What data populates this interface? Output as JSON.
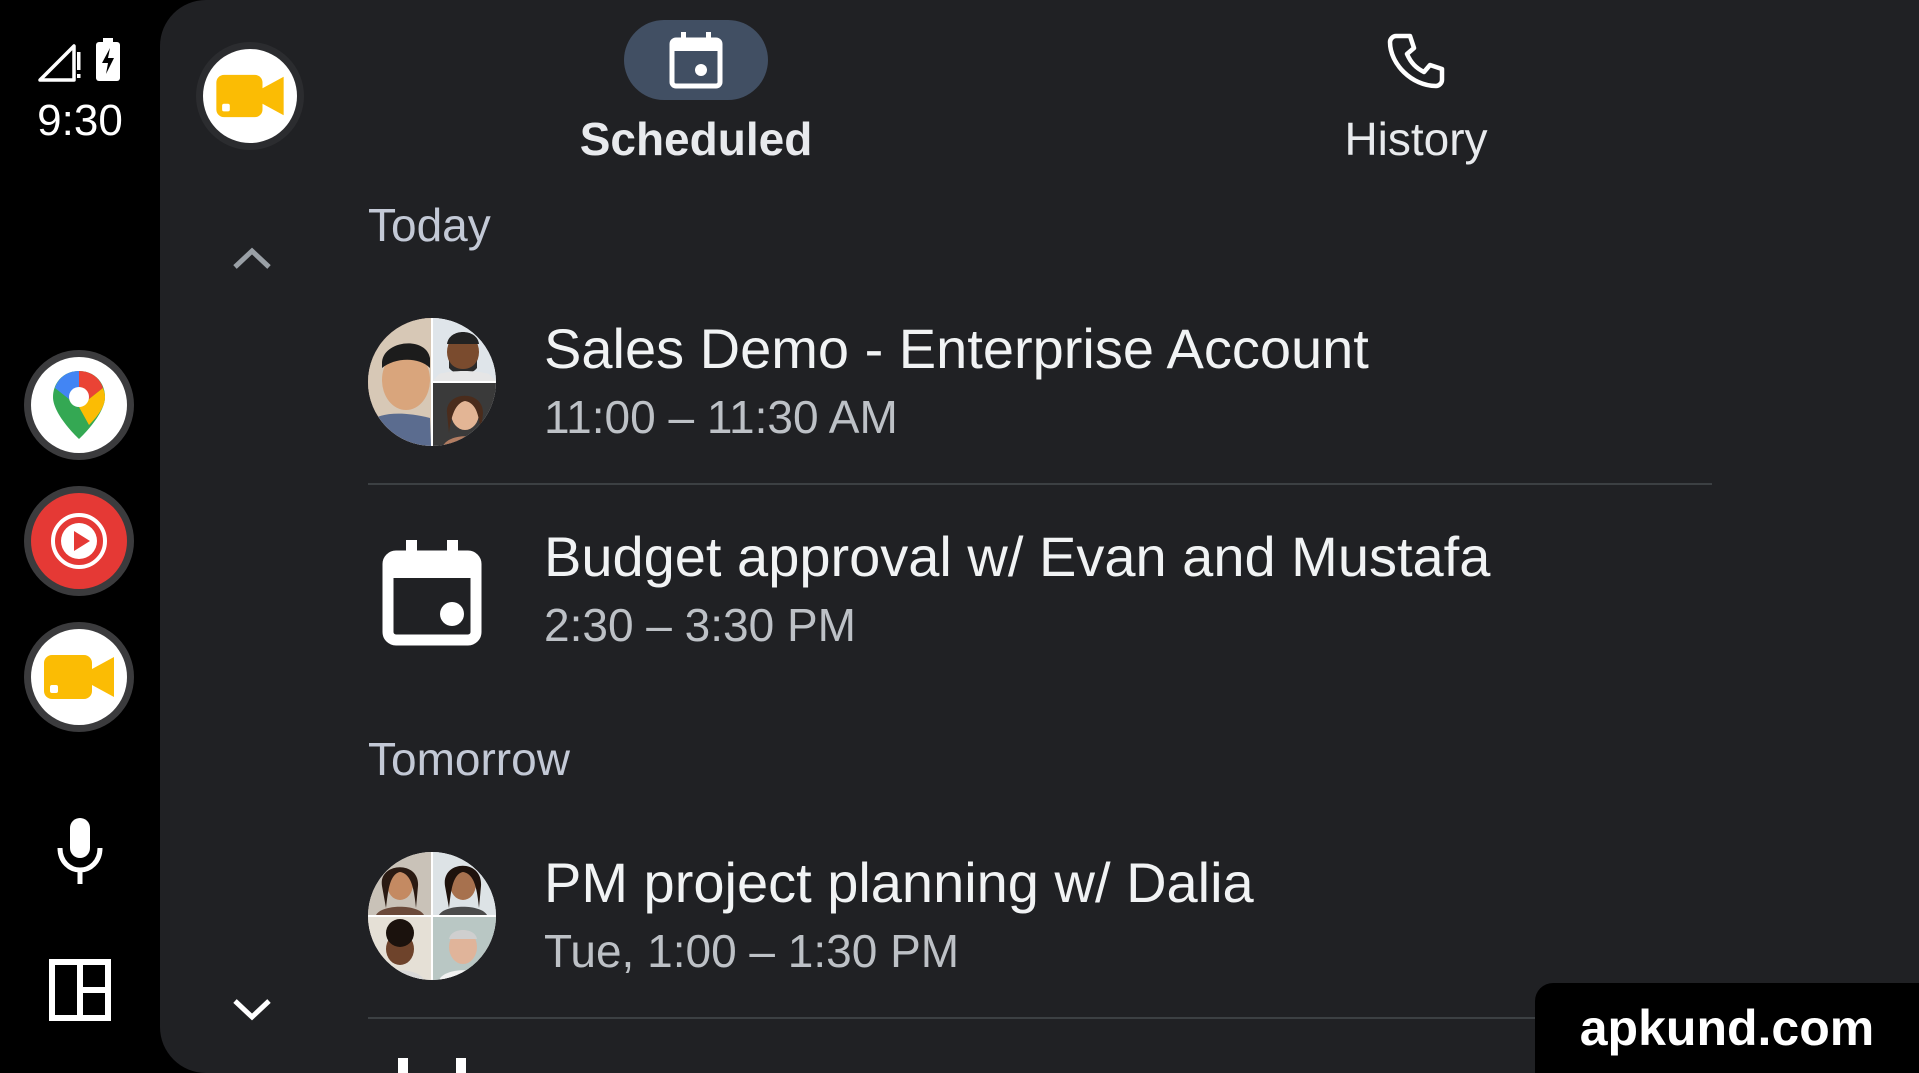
{
  "status": {
    "time": "9:30",
    "signal_icon": "signal-no-data-icon",
    "battery_icon": "battery-charging-icon"
  },
  "rail": {
    "apps": [
      {
        "name": "Google Maps",
        "icon": "maps-pin-icon"
      },
      {
        "name": "YouTube Music",
        "icon": "youtube-music-icon"
      },
      {
        "name": "Google Meet",
        "icon": "meet-camera-icon"
      }
    ],
    "mic_icon": "microphone-icon",
    "dashboard_icon": "dashboard-layout-icon"
  },
  "header": {
    "tabs": [
      {
        "label": "Scheduled",
        "icon": "calendar-icon",
        "active": true
      },
      {
        "label": "History",
        "icon": "phone-icon",
        "active": false
      }
    ]
  },
  "sections": [
    {
      "label": "Today",
      "meetings": [
        {
          "title": "Sales Demo - Enterprise Account",
          "time": "11:00 – 11:30 AM",
          "thumbnail": "participant-avatars"
        },
        {
          "title": "Budget approval w/ Evan and Mustafa",
          "time": "2:30 – 3:30 PM",
          "thumbnail": "calendar-event-icon"
        }
      ]
    },
    {
      "label": "Tomorrow",
      "meetings": [
        {
          "title": "PM project planning w/ Dalia",
          "time": "Tue, 1:00 – 1:30 PM",
          "thumbnail": "participant-avatars"
        }
      ]
    }
  ],
  "watermark": "apkund.com",
  "colors": {
    "background": "#000000",
    "card": "#202124",
    "active_tab_pill": "#414f63",
    "meet_yellow": "#fbbc04",
    "youtube_red": "#e53935",
    "divider": "#3c4043"
  }
}
